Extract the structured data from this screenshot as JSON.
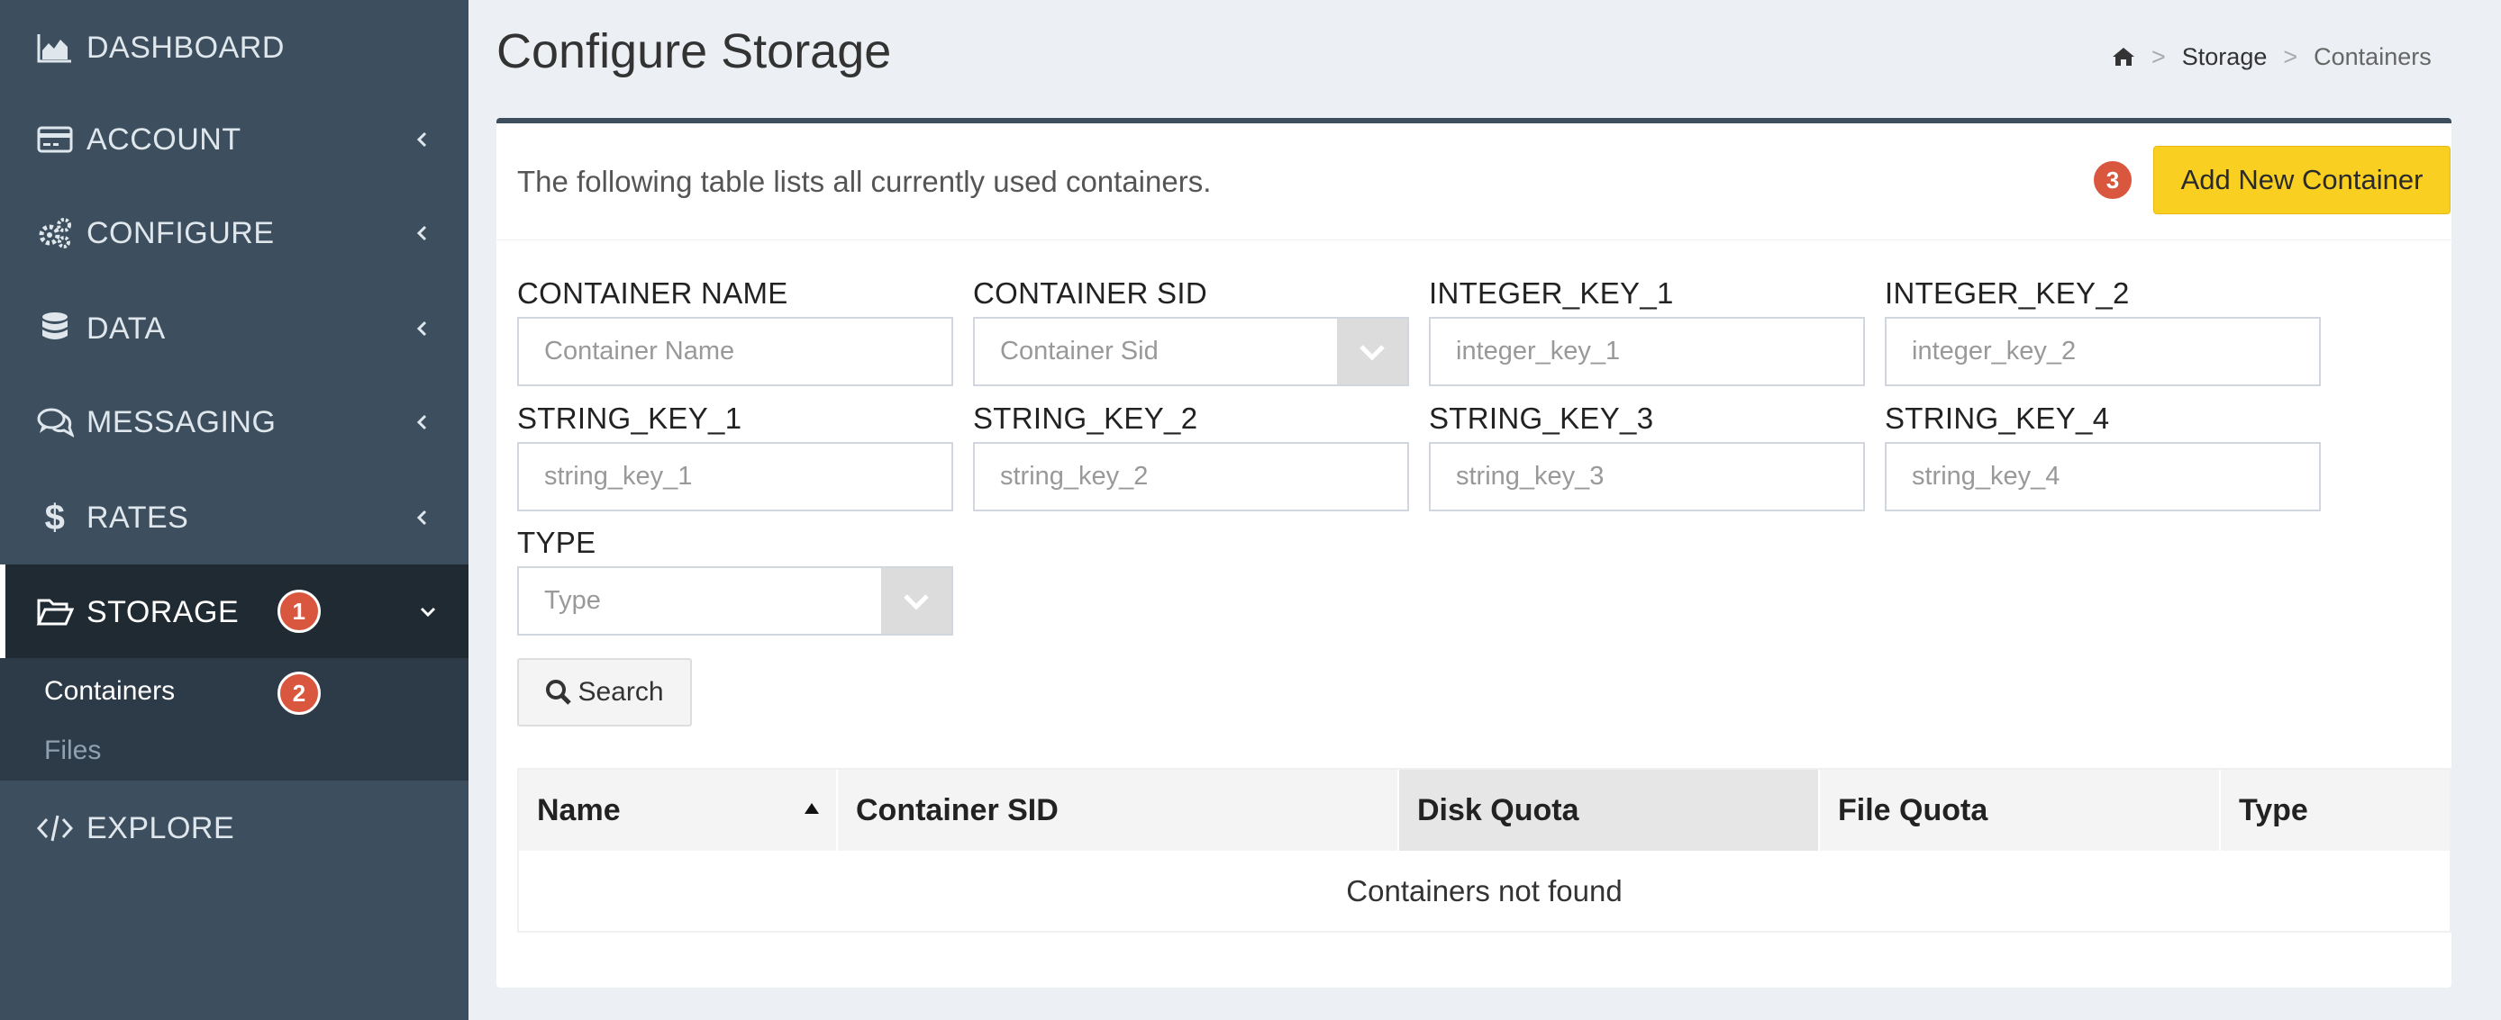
{
  "sidebar": {
    "items": [
      {
        "label": "DASHBOARD",
        "icon": "chart-area-icon"
      },
      {
        "label": "ACCOUNT",
        "icon": "credit-card-icon"
      },
      {
        "label": "CONFIGURE",
        "icon": "gears-icon"
      },
      {
        "label": "DATA",
        "icon": "database-icon"
      },
      {
        "label": "MESSAGING",
        "icon": "chat-icon"
      },
      {
        "label": "RATES",
        "icon": "dollar-icon"
      },
      {
        "label": "STORAGE",
        "icon": "folder-open-icon",
        "badge": "1"
      },
      {
        "label": "EXPLORE",
        "icon": "code-icon"
      }
    ],
    "storage_sub": [
      {
        "label": "Containers",
        "badge": "2"
      },
      {
        "label": "Files"
      }
    ]
  },
  "header": {
    "title": "Configure Storage",
    "breadcrumb": [
      "Storage",
      "Containers"
    ],
    "separator": ">"
  },
  "panel": {
    "intro": "The following table lists all currently used containers.",
    "add_badge": "3",
    "add_label": "Add New Container",
    "fields": {
      "container_name": {
        "label": "CONTAINER NAME",
        "placeholder": "Container Name"
      },
      "container_sid": {
        "label": "CONTAINER SID",
        "placeholder": "Container Sid"
      },
      "integer_key_1": {
        "label": "INTEGER_KEY_1",
        "placeholder": "integer_key_1"
      },
      "integer_key_2": {
        "label": "INTEGER_KEY_2",
        "placeholder": "integer_key_2"
      },
      "string_key_1": {
        "label": "STRING_KEY_1",
        "placeholder": "string_key_1"
      },
      "string_key_2": {
        "label": "STRING_KEY_2",
        "placeholder": "string_key_2"
      },
      "string_key_3": {
        "label": "STRING_KEY_3",
        "placeholder": "string_key_3"
      },
      "string_key_4": {
        "label": "STRING_KEY_4",
        "placeholder": "string_key_4"
      },
      "type": {
        "label": "TYPE",
        "placeholder": "Type"
      }
    },
    "search_label": "Search"
  },
  "table": {
    "columns": [
      "Name",
      "Container SID",
      "Disk Quota",
      "File Quota",
      "Type"
    ],
    "sorted_column": "Name",
    "empty_message": "Containers not found"
  },
  "colors": {
    "sidebar_bg": "#3d4f5e",
    "sidebar_active_bg": "#1f2a33",
    "badge": "#d9573f",
    "accent_button": "#f9cf22"
  }
}
